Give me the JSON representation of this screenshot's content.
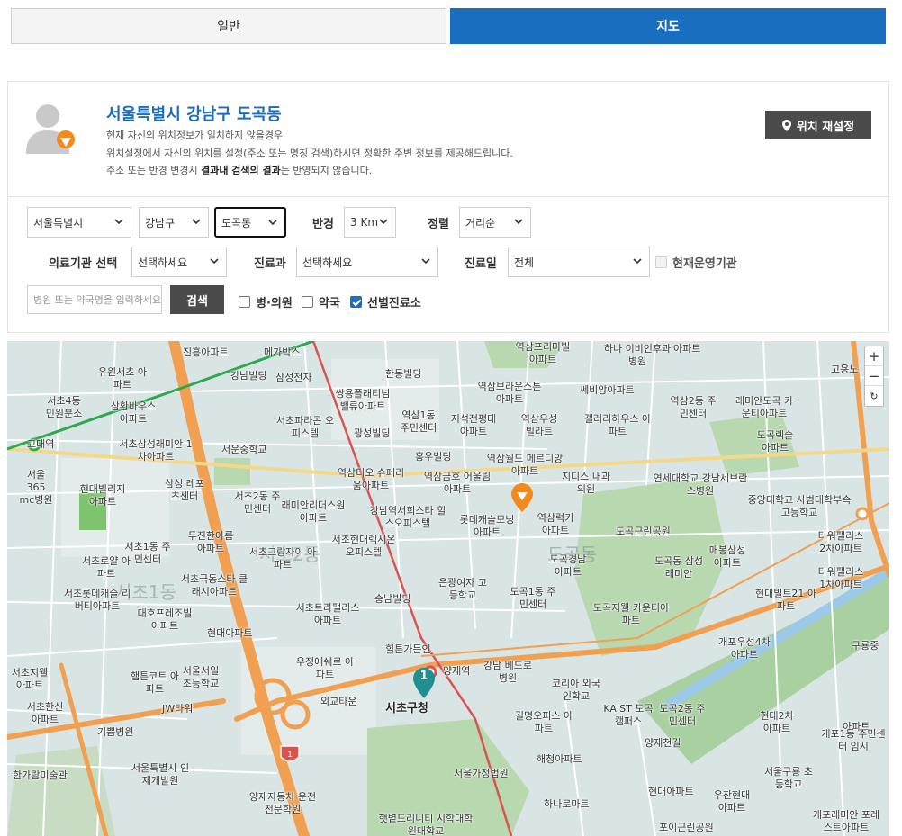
{
  "tabs": {
    "general": "일반",
    "map": "지도"
  },
  "location": {
    "title": "서울특별시 강남구 도곡동",
    "line1": "현재 자신의 위치정보가 일치하지 않을경우",
    "line2": "위치설정에서 자신의 위치를 설정(주소 또는 명칭 검색)하시면 정확한 주변 정보를 제공해드립니다.",
    "line3_pre": "주소 또는 반경 변경시 ",
    "line3_bold": "결과내 검색의 결과",
    "line3_post": "는 반영되지 않습니다.",
    "reset_label": "위치 재설정"
  },
  "filters": {
    "city": "서울특별시",
    "district": "강남구",
    "dong": "도곡동",
    "radius_label": "반경",
    "radius": "3 Km",
    "sort_label": "정렬",
    "sort": "거리순",
    "facility_label": "의료기관 선택",
    "facility": "선택하세요",
    "dept_label": "진료과",
    "dept": "선택하세요",
    "day_label": "진료일",
    "day": "전체",
    "open_now_label": "현재운영기관",
    "search_placeholder": "병원 또는 약국명을 입력하세요",
    "search_button": "검색",
    "cb_hospital": "병·의원",
    "cb_pharmacy": "약국",
    "cb_screening": "선별진료소"
  },
  "map": {
    "zoom_in": "+",
    "zoom_out": "−",
    "refresh": "↻",
    "pin_number": "1",
    "area_labels": [
      "서초1동",
      "서초2동",
      "도곡동"
    ],
    "labels": [
      "진흥아파트",
      "메가박스",
      "역삼프리마빌 아파트",
      "하나 이비인후과병원",
      "아파트",
      "유원서초 아파트",
      "강남빌딩",
      "삼성전자",
      "한동빌딩",
      "역삼브라운스톤 아파트",
      "쎄비앙아파트",
      "역삼2동 주민센터",
      "래미안도곡 카운티아파트",
      "고용노",
      "서초4동 민원분소",
      "삼환바우스 아파트",
      "쌍용플래티넘 밸류아파트",
      "역삼1동 주민센터",
      "지석전평대 아파트",
      "역삼우성 빌라트",
      "갤러리하우스 아파트",
      "교대역",
      "서초삼성래미안 1차아파트",
      "서초파라곤 오피스텔",
      "광성빌딩",
      "서운중학교",
      "홍우빌딩",
      "역삼월드 메르디앙아파트",
      "지디스 내과의원",
      "연세대학교 강남세브란스병원",
      "도곡렉슬 아파트",
      "서울365 mc병원",
      "현대빌리지 아파트",
      "삼성 레포츠센터",
      "서초2동 주민센터",
      "역삼디오 슈페리움아파트",
      "역삼금호 어울림아파트",
      "중앙대학교 사범대학부속고등학교",
      "래미안리더스원 아파트",
      "강남역서희스타 힐스오피스텔",
      "롯데캐슬모닝 아파트",
      "역삼럭키 아파트",
      "도곡근린공원",
      "타워팰리스 2차아파트",
      "서초1동 주민센터",
      "두진한아름 아파트",
      "서초그랑자이 아파트",
      "서초현대렉시온 오피스텔",
      "매봉삼성 아파트",
      "서초로얄 아파트",
      "서초극동스타 클래시아파트",
      "은광여자 고등학교",
      "도곡경남 아파트",
      "도곡동 삼성래미안",
      "타워팰리스 1차아파트",
      "서초롯데캐슬 리버티아파트",
      "대호프레조빌 아파트",
      "송남빌딩",
      "도곡1동 주민센터",
      "현대빌트21 아파트",
      "서초트라팰리스 아파트",
      "도곡지웰 카운티아파트",
      "현대아파트",
      "힐튼가든인",
      "개포우성4차 아파트",
      "구룡중",
      "서초지웰 아파트",
      "우정에쉐르 아파트",
      "강남 베드로병원",
      "양재역",
      "코리아 외국인학교",
      "햄튼코트 아파트",
      "서울서일 초등학교",
      "외교타운",
      "서초구청",
      "KAIST 도곡캠퍼스",
      "도곡2동 주민센터",
      "아파트",
      "서초한신 아파트",
      "JW타워",
      "길명오피스 아파트",
      "현대2차 아파트",
      "개포1동 주민센터 임시",
      "기쁨병원",
      "양재천길",
      "한가람미술관",
      "서울특별시 인재개발원",
      "서울가정법원",
      "해청아파트",
      "서울구룡 초등학교",
      "양재자동차 운전전문학원",
      "하나로마트",
      "현대아파트",
      "우찬현대 아파트",
      "햇볕드리니티 시학대학원대학교",
      "포이근린공원",
      "개포래미안 포레스트아파트"
    ]
  }
}
